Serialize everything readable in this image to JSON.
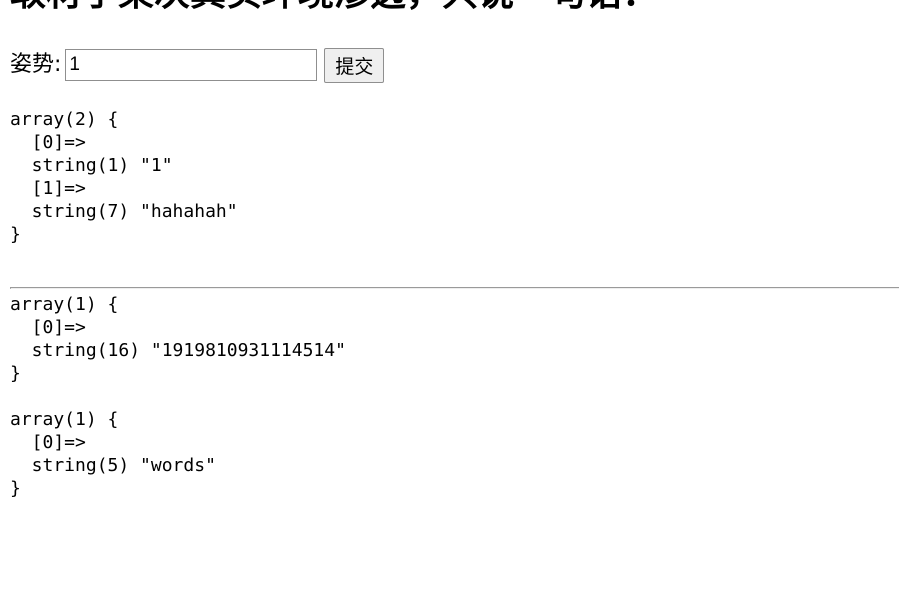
{
  "page": {
    "heading": "取材于某次真实环境渗透，只说一句话：",
    "form": {
      "label": "姿势:",
      "input_value": "1",
      "submit_label": "提交"
    },
    "dumps": [
      {
        "lines": [
          "array(2) {",
          "  [0]=>",
          "  string(1) \"1\"",
          "  [1]=>",
          "  string(7) \"hahahah\"",
          "}"
        ]
      },
      {
        "lines": [
          "array(1) {",
          "  [0]=>",
          "  string(16) \"1919810931114514\"",
          "}"
        ]
      },
      {
        "lines": [
          "array(1) {",
          "  [0]=>",
          "  string(5) \"words\"",
          "}"
        ]
      }
    ]
  }
}
